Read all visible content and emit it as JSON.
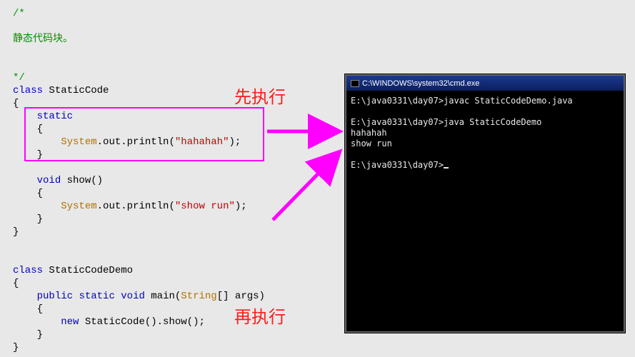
{
  "code": {
    "comment_open": "/*",
    "comment_text": "静态代码块。",
    "comment_close": "*/",
    "kw_class": "class",
    "cls1": "StaticCode",
    "brace_open": "{",
    "brace_close": "}",
    "kw_static": "static",
    "stmt1_pre": "System",
    "stmt1_out": ".out.println(",
    "stmt1_str": "\"hahahah\"",
    "stmt1_post": ");",
    "kw_void": "void",
    "fn_show": "show()",
    "stmt2_str": "\"show run\"",
    "cls2": "StaticCodeDemo",
    "kw_public": "public",
    "kw_main": "main",
    "main_params_pre": "(",
    "main_type": "String",
    "main_params_post": "[] args)",
    "kw_new": "new",
    "stmt3": " StaticCode().show();"
  },
  "labels": {
    "first": "先执行",
    "second": "再执行"
  },
  "console": {
    "title": "C:\\WINDOWS\\system32\\cmd.exe",
    "line1": "E:\\java0331\\day07>javac StaticCodeDemo.java",
    "line2": "E:\\java0331\\day07>java StaticCodeDemo",
    "line3": "hahahah",
    "line4": "show run",
    "line5": "E:\\java0331\\day07>"
  }
}
